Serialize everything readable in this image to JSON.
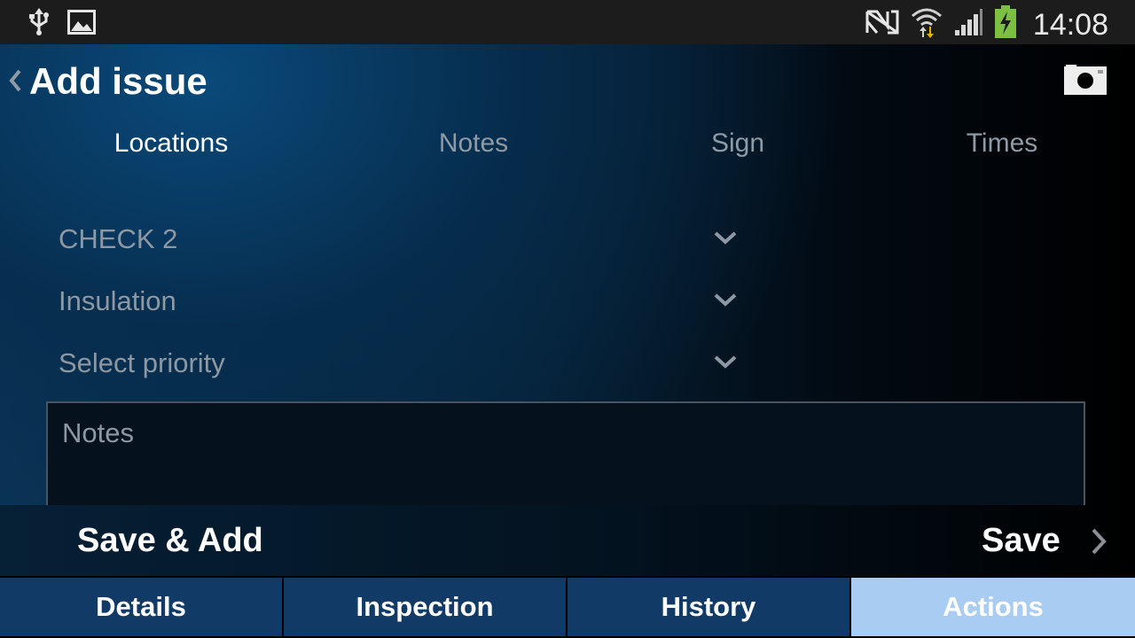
{
  "status_bar": {
    "time": "14:08",
    "left_icons": [
      "usb-icon",
      "image-icon"
    ],
    "right_icons": [
      "nfc-icon",
      "wifi-icon",
      "signal-icon",
      "battery-charging-icon"
    ]
  },
  "header": {
    "title": "Add issue",
    "back_icon": "chevron-left-icon",
    "camera_icon": "camera-icon"
  },
  "tabs": [
    {
      "label": "Locations",
      "active": true
    },
    {
      "label": "Notes",
      "active": false
    },
    {
      "label": "Sign",
      "active": false
    },
    {
      "label": "Times",
      "active": false
    }
  ],
  "form": {
    "fields": [
      {
        "value": "CHECK 2"
      },
      {
        "value": "Insulation"
      },
      {
        "value": "Select priority"
      }
    ],
    "notes_placeholder": "Notes"
  },
  "actions": {
    "save_add_label": "Save & Add",
    "save_label": "Save"
  },
  "bottom_nav": [
    {
      "label": "Details",
      "active": false
    },
    {
      "label": "Inspection",
      "active": false
    },
    {
      "label": "History",
      "active": false
    },
    {
      "label": "Actions",
      "active": true
    }
  ],
  "colors": {
    "accent_active_tab": "#a9cdf2",
    "nav_tab": "#123a66",
    "status_bar": "#1c1c1c",
    "battery": "#7bc043"
  }
}
